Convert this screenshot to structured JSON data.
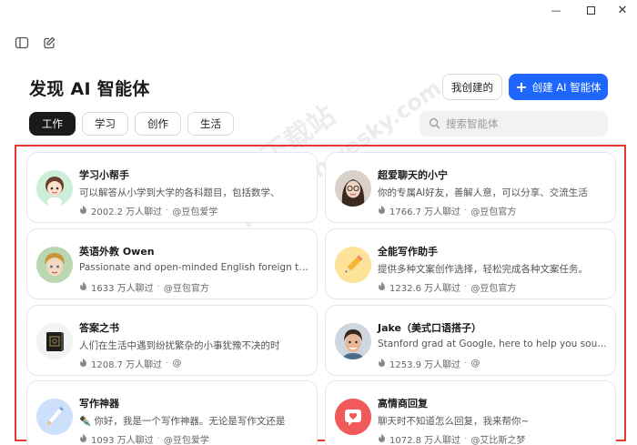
{
  "window": {
    "minimize": "—",
    "close": "✕"
  },
  "header": {
    "title": "发现 AI 智能体",
    "my_created": "我创建的",
    "create_label": "创建 AI 智能体"
  },
  "tabs": [
    {
      "label": "工作"
    },
    {
      "label": "学习"
    },
    {
      "label": "创作"
    },
    {
      "label": "生活"
    }
  ],
  "search": {
    "placeholder": "搜索智能体"
  },
  "watermark": {
    "line1": "天极下载站",
    "line2": "mydown.yesky.com"
  },
  "cards": [
    {
      "name": "学习小帮手",
      "desc": "可以解答从小学到大学的各科题目，包括数学、",
      "count": "2002.2 万人聊过",
      "author": "@豆包爱学",
      "icon": "cartoon-girl-avatar-icon"
    },
    {
      "name": "超爱聊天的小宁",
      "desc": "你的专属AI好友，善解人意，可以分享、交流生活",
      "count": "1766.7 万人聊过",
      "author": "@豆包官方",
      "icon": "girl-glasses-avatar-icon"
    },
    {
      "name": "英语外教 Owen",
      "desc": "Passionate and open-minded English foreign teac",
      "count": "1633 万人聊过",
      "author": "@豆包官方",
      "icon": "boy-avatar-icon"
    },
    {
      "name": "全能写作助手",
      "desc": "提供多种文案创作选择，轻松完成各种文案任务。",
      "count": "1232.6 万人聊过",
      "author": "@豆包官方",
      "icon": "pencil-avatar-icon"
    },
    {
      "name": "答案之书",
      "desc": "人们在生活中遇到纷扰繁杂的小事犹豫不决的时",
      "count": "1208.7 万人聊过",
      "author": "@",
      "icon": "book-avatar-icon"
    },
    {
      "name": "Jake（美式口语搭子）",
      "desc": "Stanford grad at Google, here to help you sound l",
      "count": "1253.9 万人聊过",
      "author": "@",
      "icon": "man-avatar-icon"
    },
    {
      "name": "写作神器",
      "desc": "✒️ 你好，我是一个写作神器。无论是写作文还是",
      "count": "1093 万人聊过",
      "author": "@豆包爱学",
      "icon": "pen-avatar-icon"
    },
    {
      "name": "高情商回复",
      "desc": "聊天时不知道怎么回复，我来帮你~",
      "count": "1072.8 万人聊过",
      "author": "@艾比斯之梦",
      "icon": "heart-message-avatar-icon"
    }
  ],
  "colors": {
    "accent": "#1d66ff",
    "frame": "#e53935",
    "active_tab": "#1a1a1a"
  }
}
